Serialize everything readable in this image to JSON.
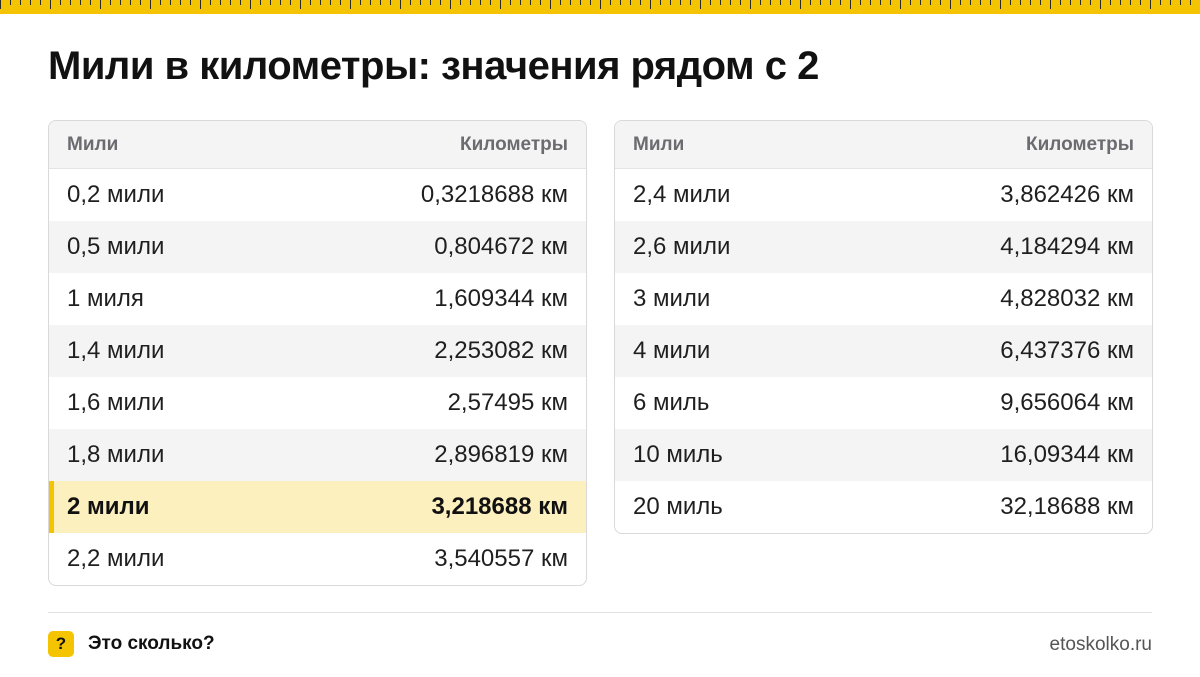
{
  "title": "Мили в километры: значения рядом с 2",
  "left_table": {
    "col_miles": "Мили",
    "col_km": "Километры",
    "rows": [
      {
        "miles": "0,2 мили",
        "km": "0,3218688 км"
      },
      {
        "miles": "0,5 мили",
        "km": "0,804672 км"
      },
      {
        "miles": "1 миля",
        "km": "1,609344 км"
      },
      {
        "miles": "1,4 мили",
        "km": "2,253082 км"
      },
      {
        "miles": "1,6 мили",
        "km": "2,57495 км"
      },
      {
        "miles": "1,8 мили",
        "km": "2,896819 км"
      },
      {
        "miles": "2 мили",
        "km": "3,218688 км",
        "highlight": true
      },
      {
        "miles": "2,2 мили",
        "km": "3,540557 км"
      }
    ]
  },
  "right_table": {
    "col_miles": "Мили",
    "col_km": "Километры",
    "rows": [
      {
        "miles": "2,4 мили",
        "km": "3,862426 км"
      },
      {
        "miles": "2,6 мили",
        "km": "4,184294 км"
      },
      {
        "miles": "3 мили",
        "km": "4,828032 км"
      },
      {
        "miles": "4 мили",
        "km": "6,437376 км"
      },
      {
        "miles": "6 миль",
        "km": "9,656064 км"
      },
      {
        "miles": "10 миль",
        "km": "16,09344 км"
      },
      {
        "miles": "20 миль",
        "km": "32,18688 км"
      }
    ]
  },
  "footer": {
    "logo_glyph": "?",
    "brand": "Это сколько?",
    "site": "etoskolko.ru"
  },
  "colors": {
    "accent": "#f5c400",
    "highlight_row": "#fdf0bf"
  }
}
